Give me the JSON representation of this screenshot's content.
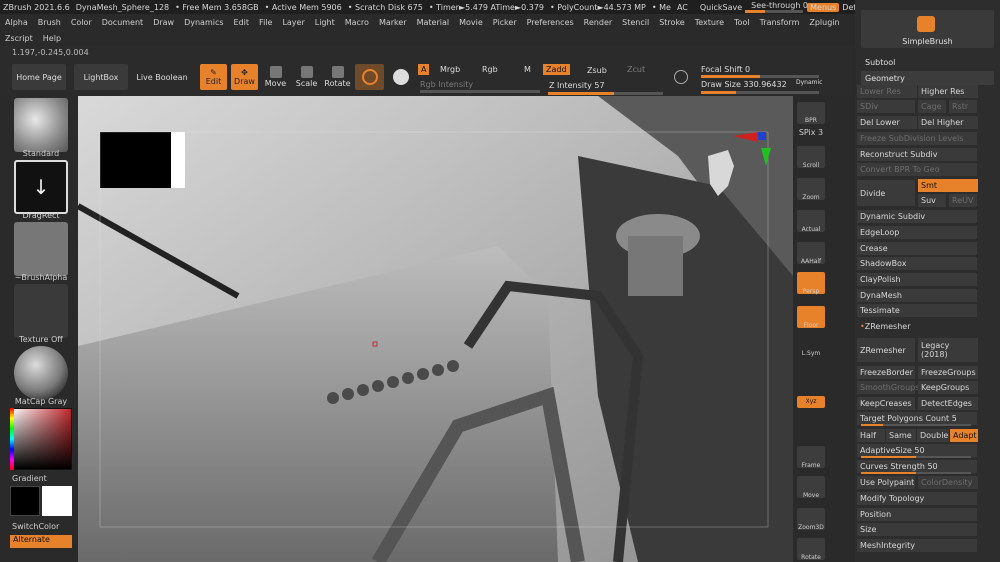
{
  "titlebar": {
    "app": "ZBrush 2021.6.6",
    "doc": "DynaMesh_Sphere_128",
    "free_mem": "• Free Mem 3.658GB",
    "active_mem": "• Active Mem 5906",
    "scratch": "• Scratch Disk 675",
    "timer": "• Timer►5.479 ATime►0.379",
    "polycount": "• PolyCount►44.573 MP",
    "me": "• Me",
    "ac": "AC",
    "quicksave": "QuickSave",
    "seethrough": "See-through 0",
    "seethrough_value": 0,
    "menus": "Menus",
    "script": "DefaultZScript"
  },
  "menu_row1": [
    "Alpha",
    "Brush",
    "Color",
    "Document",
    "Draw",
    "Dynamics",
    "Edit",
    "File",
    "Layer",
    "Light",
    "Macro",
    "Marker",
    "Material",
    "Movie",
    "Picker",
    "Preferences",
    "Render",
    "Stencil",
    "Stroke",
    "Texture",
    "Tool",
    "Transform",
    "Zplugin"
  ],
  "menu_row2": [
    "Zscript",
    "Help"
  ],
  "coords": "1.197,-0.245,0.004",
  "toolbar": {
    "home": "Home Page",
    "lightbox": "LightBox",
    "live_boolean": "Live Boolean",
    "edit": "Edit",
    "draw": "Draw",
    "move": "Move",
    "scale": "Scale",
    "rotate": "Rotate",
    "a": "A",
    "mrgb": "Mrgb",
    "rgb": "Rgb",
    "m": "M",
    "zadd": "Zadd",
    "zsub": "Zsub",
    "zcut": "Zcut",
    "rgb_intensity": "Rgb Intensity",
    "z_intensity": "Z Intensity 57",
    "z_intensity_value": 57,
    "focal_shift": "Focal Shift 0",
    "focal_shift_value": 0,
    "draw_size": "Draw Size 330.96432",
    "dynamic": "Dynamic"
  },
  "left_panel": {
    "standard": "Standard",
    "dragrect": "DragRect",
    "brushalpha": "~BrushAlpha",
    "texture_off": "Texture Off",
    "matcap": "MatCap Gray",
    "gradient": "Gradient",
    "switchcolor": "SwitchColor",
    "alternate": "Alternate"
  },
  "right_strip": [
    "BPR",
    "SPix 3",
    "Scroll",
    "Zoom",
    "Actual",
    "AAHalf",
    "Persp",
    "Floor",
    "L.Sym",
    "Xyz",
    "Frame",
    "Move",
    "Zoom3D",
    "Rotate"
  ],
  "right_panel": {
    "simplebrush": "SimpleBrush",
    "subtool": "Subtool",
    "geometry": "Geometry",
    "lower_res": "Lower Res",
    "higher_res": "Higher Res",
    "sdiv": "SDiv",
    "cage": "Cage",
    "rstr": "Rstr",
    "del_lower": "Del Lower",
    "del_higher": "Del Higher",
    "freeze_subdiv": "Freeze SubDivision Levels",
    "reconstruct_subdiv": "Reconstruct Subdiv",
    "convert_bpr": "Convert BPR To Geo",
    "divide": "Divide",
    "smt": "Smt",
    "suv": "Suv",
    "reuv": "ReUV",
    "dynamic_subdiv": "Dynamic Subdiv",
    "edgeloop": "EdgeLoop",
    "crease": "Crease",
    "shadowbox": "ShadowBox",
    "claypolish": "ClayPolish",
    "dynamesh": "DynaMesh",
    "tessimate": "Tessimate",
    "zremesher_head": "ZRemesher",
    "zremesher": "ZRemesher",
    "legacy": "Legacy (2018)",
    "freezeborder": "FreezeBorder",
    "freezegroups": "FreezeGroups",
    "smoothgroups": "SmoothGroups",
    "keepgroups": "KeepGroups",
    "keepcreases": "KeepCreases",
    "detectedges": "DetectEdges",
    "target_polygons": "Target Polygons Count 5",
    "target_polygons_value": 5,
    "half": "Half",
    "same": "Same",
    "double": "Double",
    "adapt": "Adapt",
    "adaptivesize": "AdaptiveSize 50",
    "adaptivesize_value": 50,
    "curves_strength": "Curves Strength 50",
    "curves_strength_value": 50,
    "use_polypaint": "Use Polypaint",
    "colordensity": "ColorDensity",
    "modify_topology": "Modify Topology",
    "position": "Position",
    "size": "Size",
    "meshintegrity": "MeshIntegrity"
  },
  "colors": {
    "accent": "#e8822a",
    "panel": "#2a2a2a",
    "button": "#3a3a3a"
  }
}
